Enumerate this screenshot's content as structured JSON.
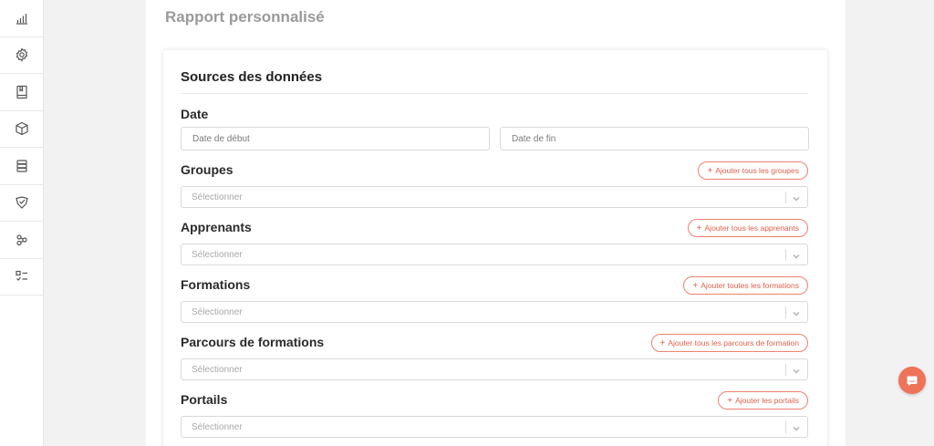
{
  "sidebar": {
    "items": [
      {
        "icon": "bar-chart-icon"
      },
      {
        "icon": "gear-icon"
      },
      {
        "icon": "book-icon"
      },
      {
        "icon": "cube-icon"
      },
      {
        "icon": "database-icon"
      },
      {
        "icon": "shield-icon"
      },
      {
        "icon": "network-icon"
      },
      {
        "icon": "checklist-icon"
      }
    ]
  },
  "page": {
    "title": "Rapport personnalisé"
  },
  "card": {
    "title": "Sources des données",
    "date": {
      "label": "Date",
      "start_placeholder": "Date de début",
      "end_placeholder": "Date de fin"
    },
    "groupes": {
      "label": "Groupes",
      "button": "Ajouter tous les groupes",
      "placeholder": "Sélectionner"
    },
    "apprenants": {
      "label": "Apprenants",
      "button": "Ajouter tous les apprenants",
      "placeholder": "Sélectionner"
    },
    "formations": {
      "label": "Formations",
      "button": "Ajouter toutes les formations",
      "placeholder": "Sélectionner"
    },
    "parcours": {
      "label": "Parcours de formations",
      "button": "Ajouter tous les parcours de formation",
      "placeholder": "Sélectionner"
    },
    "portails": {
      "label": "Portails",
      "button": "Ajouter les portails",
      "placeholder": "Sélectionner"
    }
  },
  "colors": {
    "accent": "#ef7358",
    "button_text": "#e0604d"
  },
  "chat": {
    "icon": "chat-icon"
  }
}
